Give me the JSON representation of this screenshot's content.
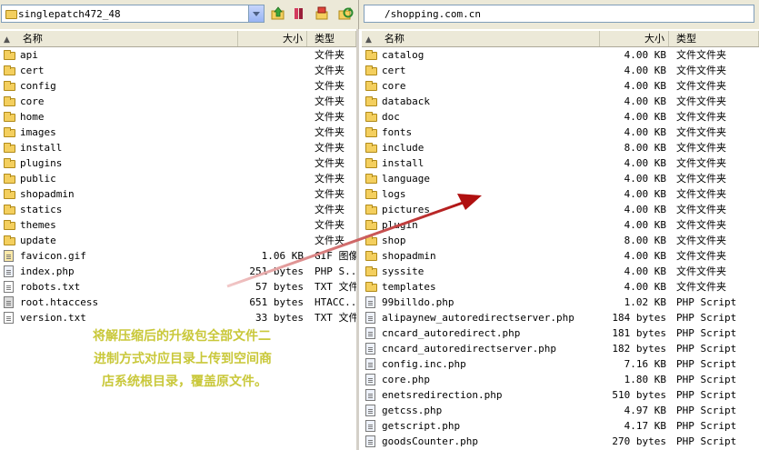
{
  "left_toolbar": {
    "site_name": "singlepatch472_48",
    "icons": [
      "folder-up-icon",
      "new-folder-icon",
      "home-folder-icon",
      "refresh-icon"
    ]
  },
  "right_toolbar": {
    "path": "/shopping.com.cn"
  },
  "left_panel": {
    "columns": {
      "name": "名称",
      "size": "大小",
      "type": "类型"
    },
    "files": [
      {
        "name": "api",
        "size": "",
        "type": "文件夹",
        "icon": "folder"
      },
      {
        "name": "cert",
        "size": "",
        "type": "文件夹",
        "icon": "folder"
      },
      {
        "name": "config",
        "size": "",
        "type": "文件夹",
        "icon": "folder"
      },
      {
        "name": "core",
        "size": "",
        "type": "文件夹",
        "icon": "folder"
      },
      {
        "name": "home",
        "size": "",
        "type": "文件夹",
        "icon": "folder"
      },
      {
        "name": "images",
        "size": "",
        "type": "文件夹",
        "icon": "folder"
      },
      {
        "name": "install",
        "size": "",
        "type": "文件夹",
        "icon": "folder"
      },
      {
        "name": "plugins",
        "size": "",
        "type": "文件夹",
        "icon": "folder"
      },
      {
        "name": "public",
        "size": "",
        "type": "文件夹",
        "icon": "folder"
      },
      {
        "name": "shopadmin",
        "size": "",
        "type": "文件夹",
        "icon": "folder"
      },
      {
        "name": "statics",
        "size": "",
        "type": "文件夹",
        "icon": "folder"
      },
      {
        "name": "themes",
        "size": "",
        "type": "文件夹",
        "icon": "folder"
      },
      {
        "name": "update",
        "size": "",
        "type": "文件夹",
        "icon": "folder"
      },
      {
        "name": "favicon.gif",
        "size": "1.06 KB",
        "type": "GIF 图像",
        "icon": "img"
      },
      {
        "name": "index.php",
        "size": "251 bytes",
        "type": "PHP S...",
        "icon": "php"
      },
      {
        "name": "robots.txt",
        "size": "57 bytes",
        "type": "TXT 文件",
        "icon": "txt"
      },
      {
        "name": "root.htaccess",
        "size": "651 bytes",
        "type": "HTACC...",
        "icon": "sys"
      },
      {
        "name": "version.txt",
        "size": "33 bytes",
        "type": "TXT 文件",
        "icon": "txt"
      }
    ]
  },
  "right_panel": {
    "columns": {
      "name": "名称",
      "size": "大小",
      "type": "类型"
    },
    "files": [
      {
        "name": "catalog",
        "size": "4.00 KB",
        "type": "文件文件夹",
        "icon": "folder"
      },
      {
        "name": "cert",
        "size": "4.00 KB",
        "type": "文件文件夹",
        "icon": "folder"
      },
      {
        "name": "core",
        "size": "4.00 KB",
        "type": "文件文件夹",
        "icon": "folder"
      },
      {
        "name": "databack",
        "size": "4.00 KB",
        "type": "文件文件夹",
        "icon": "folder"
      },
      {
        "name": "doc",
        "size": "4.00 KB",
        "type": "文件文件夹",
        "icon": "folder"
      },
      {
        "name": "fonts",
        "size": "4.00 KB",
        "type": "文件文件夹",
        "icon": "folder"
      },
      {
        "name": "include",
        "size": "8.00 KB",
        "type": "文件文件夹",
        "icon": "folder"
      },
      {
        "name": "install",
        "size": "4.00 KB",
        "type": "文件文件夹",
        "icon": "folder"
      },
      {
        "name": "language",
        "size": "4.00 KB",
        "type": "文件文件夹",
        "icon": "folder"
      },
      {
        "name": "logs",
        "size": "4.00 KB",
        "type": "文件文件夹",
        "icon": "folder"
      },
      {
        "name": "pictures",
        "size": "4.00 KB",
        "type": "文件文件夹",
        "icon": "folder"
      },
      {
        "name": "plugin",
        "size": "4.00 KB",
        "type": "文件文件夹",
        "icon": "folder"
      },
      {
        "name": "shop",
        "size": "8.00 KB",
        "type": "文件文件夹",
        "icon": "folder"
      },
      {
        "name": "shopadmin",
        "size": "4.00 KB",
        "type": "文件文件夹",
        "icon": "folder"
      },
      {
        "name": "syssite",
        "size": "4.00 KB",
        "type": "文件文件夹",
        "icon": "folder"
      },
      {
        "name": "templates",
        "size": "4.00 KB",
        "type": "文件文件夹",
        "icon": "folder"
      },
      {
        "name": "99billdo.php",
        "size": "1.02 KB",
        "type": "PHP Script",
        "icon": "php"
      },
      {
        "name": "alipaynew_autoredirectserver.php",
        "size": "184 bytes",
        "type": "PHP Script",
        "icon": "php"
      },
      {
        "name": "cncard_autoredirect.php",
        "size": "181 bytes",
        "type": "PHP Script",
        "icon": "php"
      },
      {
        "name": "cncard_autoredirectserver.php",
        "size": "182 bytes",
        "type": "PHP Script",
        "icon": "php"
      },
      {
        "name": "config.inc.php",
        "size": "7.16 KB",
        "type": "PHP Script",
        "icon": "php"
      },
      {
        "name": "core.php",
        "size": "1.80 KB",
        "type": "PHP Script",
        "icon": "php"
      },
      {
        "name": "enetsredirection.php",
        "size": "510 bytes",
        "type": "PHP Script",
        "icon": "php"
      },
      {
        "name": "getcss.php",
        "size": "4.97 KB",
        "type": "PHP Script",
        "icon": "php"
      },
      {
        "name": "getscript.php",
        "size": "4.17 KB",
        "type": "PHP Script",
        "icon": "php"
      },
      {
        "name": "goodsCounter.php",
        "size": "270 bytes",
        "type": "PHP Script",
        "icon": "php"
      }
    ]
  },
  "annotation": {
    "lines": [
      "将解压缩后的升级包全部文件二",
      "进制方式对应目录上传到空间商",
      "店系统根目录，覆盖原文件。"
    ],
    "color": "#c9c83a",
    "arrow_color": "#b01010"
  }
}
